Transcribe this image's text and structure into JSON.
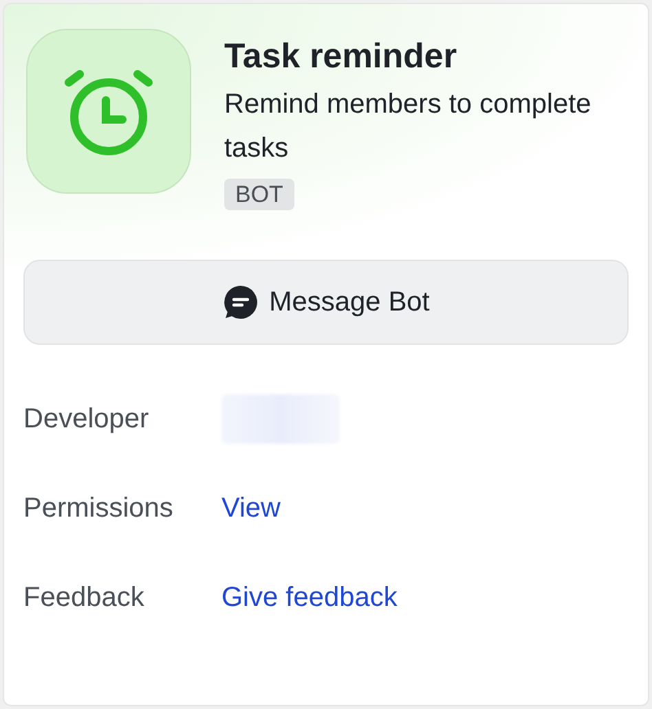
{
  "bot": {
    "name": "Task reminder",
    "description": "Remind members to complete tasks",
    "badge": "BOT"
  },
  "action_button": {
    "label": "Message Bot"
  },
  "details": [
    {
      "label": "Developer",
      "kind": "redacted"
    },
    {
      "label": "Permissions",
      "kind": "link",
      "value": "View"
    },
    {
      "label": "Feedback",
      "kind": "link",
      "value": "Give feedback"
    }
  ]
}
